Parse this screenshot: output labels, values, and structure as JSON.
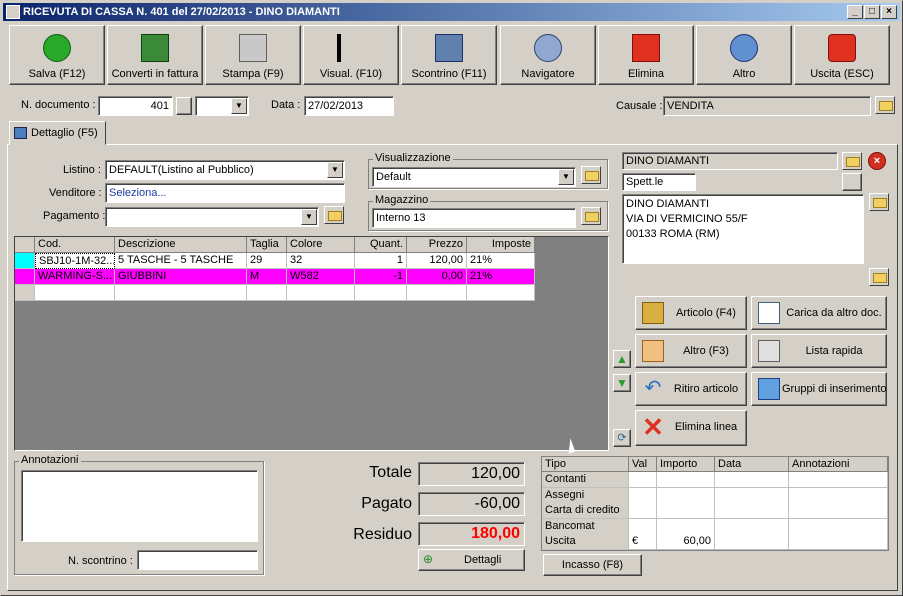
{
  "window": {
    "title": "RICEVUTA DI CASSA N. 401 del 27/02/2013 - DINO DIAMANTI"
  },
  "toolbar": [
    {
      "label": "Salva (F12)",
      "icon": "check-icon"
    },
    {
      "label": "Converti in fattura",
      "icon": "convert-icon"
    },
    {
      "label": "Stampa (F9)",
      "icon": "printer-icon"
    },
    {
      "label": "Visual. (F10)",
      "icon": "magic-wand-icon"
    },
    {
      "label": "Scontrino (F11)",
      "icon": "cash-register-icon"
    },
    {
      "label": "Navigatore",
      "icon": "compass-icon"
    },
    {
      "label": "Elimina",
      "icon": "delete-x-icon"
    },
    {
      "label": "Altro",
      "icon": "magnifier-icon"
    },
    {
      "label": "Uscita (ESC)",
      "icon": "power-icon"
    }
  ],
  "header": {
    "doc_label": "N. documento :",
    "doc_number": "401",
    "data_label": "Data :",
    "data_value": "27/02/2013",
    "causale_label": "Causale :",
    "causale_value": "VENDITA"
  },
  "tab": {
    "label": "Dettaglio (F5)"
  },
  "form": {
    "listino_label": "Listino :",
    "listino_value": "DEFAULT(Listino al Pubblico)",
    "venditore_label": "Venditore :",
    "venditore_value": "Seleziona...",
    "pagamento_label": "Pagamento :",
    "pagamento_value": "",
    "visualizzazione_label": "Visualizzazione",
    "visualizzazione_value": "Default",
    "magazzino_label": "Magazzino",
    "magazzino_value": "Interno 13"
  },
  "customer": {
    "name": "DINO DIAMANTI",
    "title": "Spett.le",
    "address_lines": [
      "DINO DIAMANTI",
      "VIA DI VERMICINO 55/F",
      "00133 ROMA (RM)"
    ]
  },
  "grid": {
    "columns": [
      "Cod.",
      "Descrizione",
      "Taglia",
      "Colore",
      "Quant.",
      "Prezzo",
      "Imposte"
    ],
    "rows": [
      {
        "cod": "SBJ10-1M-32...",
        "descrizione": "5 TASCHE - 5 TASCHE",
        "taglia": "29",
        "colore": "32",
        "quant": "1",
        "prezzo": "120,00",
        "imposte": "21%"
      },
      {
        "cod": "WARMING-S...",
        "descrizione": "GIUBBINI",
        "taglia": "M",
        "colore": "W582",
        "quant": "-1",
        "prezzo": "0,00",
        "imposte": "21%"
      }
    ]
  },
  "actions": {
    "articolo": "Articolo (F4)",
    "carica": "Carica da altro doc.",
    "altro": "Altro (F3)",
    "lista_rapida": "Lista rapida",
    "ritiro": "Ritiro articolo",
    "gruppi": "Gruppi di inserimento",
    "elimina_linea": "Elimina linea"
  },
  "notes": {
    "label": "Annotazioni",
    "scontrino_label": "N. scontrino :",
    "scontrino_value": ""
  },
  "totals": {
    "totale_label": "Totale",
    "totale": "120,00",
    "pagato_label": "Pagato",
    "pagato": "-60,00",
    "residuo_label": "Residuo",
    "residuo": "180,00",
    "dettagli": "Dettagli"
  },
  "payments": {
    "columns": [
      "Tipo",
      "Val",
      "Importo",
      "Data",
      "Annotazioni"
    ],
    "rows": [
      {
        "tipo": "Contanti",
        "val": "",
        "importo": ""
      },
      {
        "tipo": "Assegni",
        "val": "",
        "importo": ""
      },
      {
        "tipo": "Carta di credito",
        "val": "",
        "importo": ""
      },
      {
        "tipo": "Bancomat",
        "val": "",
        "importo": ""
      },
      {
        "tipo": "Uscita",
        "val": "€",
        "importo": "60,00"
      }
    ],
    "incasso": "Incasso (F8)"
  },
  "colors": {
    "selected_row": "#ff00ff",
    "row_marker": "#00ffff",
    "residuo": "#ff0000",
    "title_bar": "#0a246a"
  }
}
